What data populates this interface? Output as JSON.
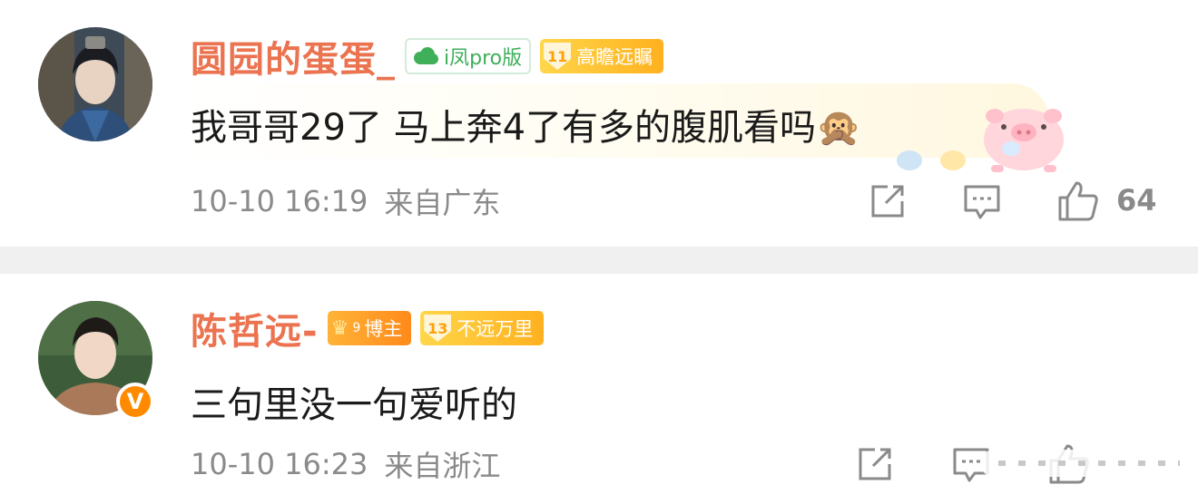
{
  "comments": [
    {
      "username": "圆园的蛋蛋_",
      "device_badge": "i凤pro版",
      "level_badge": {
        "level": "11",
        "title": "高瞻远瞩"
      },
      "content": "我哥哥29了 马上奔4了有多的腹肌看吗",
      "content_emoji": "🙊",
      "timestamp": "10-10 16:19",
      "location": "来自广东",
      "like_count": "64",
      "icons": {
        "share": "share-icon",
        "comment": "comment-icon",
        "like": "thumbs-up-icon",
        "sticker": "pig-sticker"
      }
    },
    {
      "username": "陈哲远-",
      "blogger_badge": {
        "crown_level": "9",
        "label": "博主"
      },
      "level_badge": {
        "level": "13",
        "title": "不远万里"
      },
      "verified_mark": "V",
      "content": "三句里没一句爱听的",
      "timestamp": "10-10 16:23",
      "location": "来自浙江",
      "icons": {
        "share": "share-icon",
        "comment": "comment-icon",
        "like": "thumbs-up-icon"
      }
    }
  ],
  "colors": {
    "username": "#eb7350",
    "meta": "#8a8a8a",
    "content": "#1a1a1a",
    "separator": "#f0f0f0",
    "level_badge": "#ffb11f",
    "ifeng_green": "#3faf5a",
    "verified": "#ff8a00"
  }
}
